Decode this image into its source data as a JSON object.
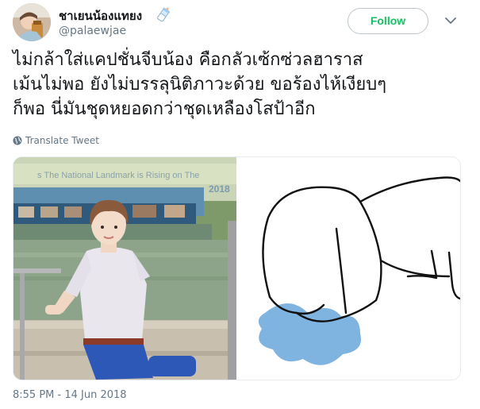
{
  "user": {
    "display_name": "ชาเยนน้องแทยง",
    "handle": "@palaewjae",
    "emoji_icon": "baby-bottle-icon",
    "avatar_icon": "avatar-photo"
  },
  "follow": {
    "label": "Follow"
  },
  "more_icon": "chevron-down-icon",
  "tweet": {
    "lines": [
      "ไม่กล้าใส่แคปชั่นจีบน้อง คือกลัวเซ้กซ่วลฮาราส",
      "เม้นไม่พอ ยังไม่บรรลุนิติภาวะด้วย ขอร้องไห้เงียบๆ",
      "ก็พอ นี่มันชุดหยอดกว่าชุดเหลืองโสป้าอีก"
    ]
  },
  "translate": {
    "label": "Translate Tweet",
    "icon": "globe-icon"
  },
  "media": {
    "photo_sign_text": "s The National Landmark is Rising on The",
    "photo_sign_number": "2018"
  },
  "timestamp": "8:55 PM - 14 Jun 2018",
  "colors": {
    "follow_text": "#17bf63",
    "secondary_text": "#657786",
    "primary_text": "#14171a",
    "puddle": "#7fb3e0"
  }
}
